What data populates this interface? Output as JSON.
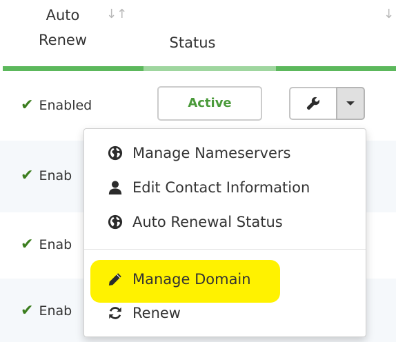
{
  "table": {
    "headers": {
      "auto_renew": "Auto\nRenew",
      "status": "Status"
    },
    "header_bar_colors": [
      "#5cb85c",
      "#9fd69f",
      "#5cb85c"
    ],
    "rows": [
      {
        "auto_renew": "Enabled",
        "status": "Active"
      },
      {
        "auto_renew": "Enab"
      },
      {
        "auto_renew": "Enab"
      },
      {
        "auto_renew": "Enab"
      }
    ],
    "row_backgrounds": [
      "#ffffff",
      "#f5f8fb",
      "#ffffff",
      "#f5f8fb"
    ]
  },
  "actions": {
    "wrench_icon": "wrench-icon",
    "caret_icon": "caret-down-icon"
  },
  "dropdown": {
    "items": [
      {
        "label": "Manage Nameservers",
        "icon": "globe-icon"
      },
      {
        "label": "Edit Contact Information",
        "icon": "user-icon"
      },
      {
        "label": "Auto Renewal Status",
        "icon": "globe-icon"
      },
      {
        "label": "Manage Domain",
        "icon": "pencil-icon"
      },
      {
        "label": "Renew",
        "icon": "refresh-icon"
      }
    ],
    "highlight_color": "#fff200"
  },
  "colors": {
    "check": "#3b7d1e",
    "active_text": "#4a9a3a",
    "row_alt_bg": "#f5f8fb"
  }
}
